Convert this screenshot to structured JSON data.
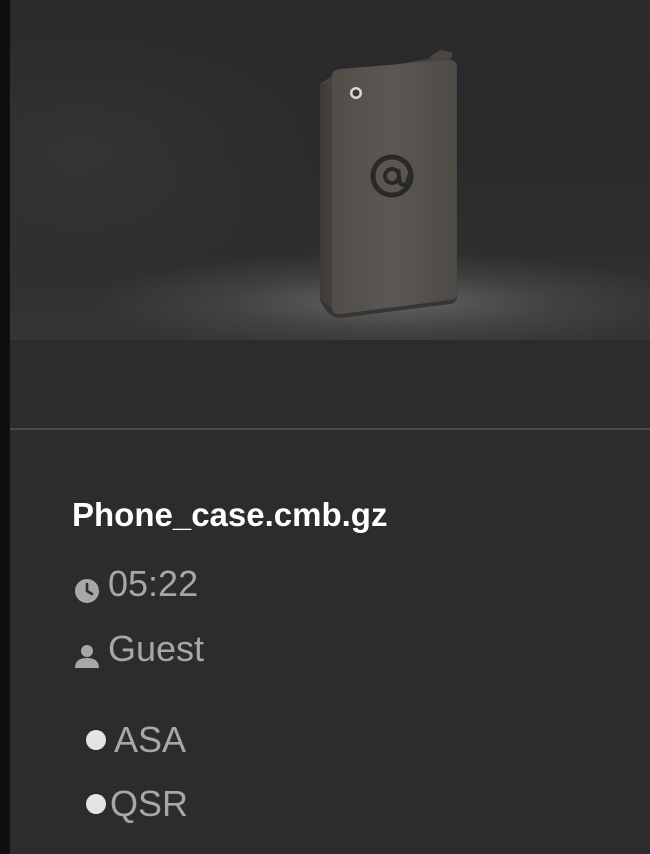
{
  "file": {
    "name": "Phone_case.cmb.gz",
    "duration": "05:22",
    "owner": "Guest",
    "tags": [
      "ASA",
      "QSR"
    ],
    "thumbnail_icon": "phone-case-3d-model"
  },
  "colors": {
    "background": "#2c2c2e",
    "title": "#ffffff",
    "meta_text": "#a7a7a9",
    "bullet": "#e4e4e4"
  }
}
